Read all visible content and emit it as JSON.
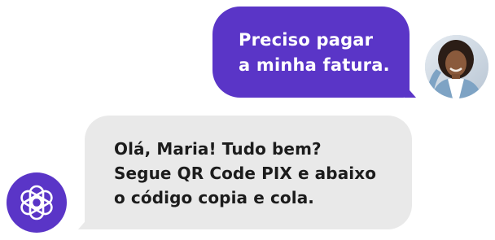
{
  "colors": {
    "outgoing_bubble": "#5a35c7",
    "incoming_bubble": "#e9e9e9",
    "bot_avatar": "#5a35c7",
    "outgoing_text": "#ffffff",
    "incoming_text": "#1c1c1c"
  },
  "messages": {
    "outgoing": {
      "lines": [
        "Preciso pagar",
        "a minha fatura."
      ],
      "sender_avatar": "user-photo-avatar"
    },
    "incoming": {
      "lines": [
        "Olá, Maria! Tudo bem?",
        "Segue QR Code PIX e abaixo",
        "o código copia e cola."
      ],
      "sender_icon": "openai-logo-icon"
    }
  }
}
